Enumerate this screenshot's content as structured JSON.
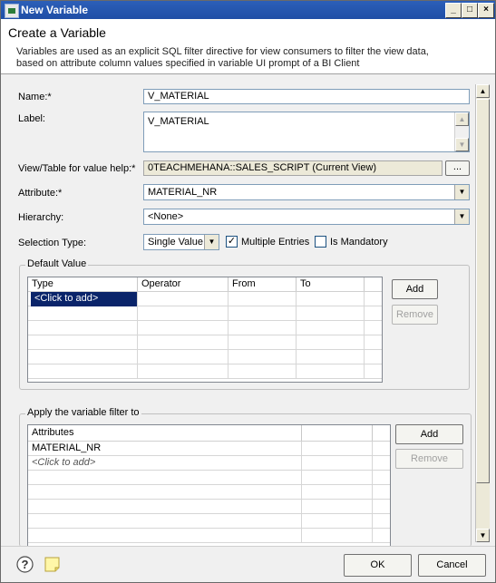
{
  "window": {
    "title": "New Variable",
    "buttons": {
      "minimize": "_",
      "maximize": "□",
      "close": "×"
    }
  },
  "header": {
    "title": "Create a Variable",
    "description": "Variables are used as an explicit SQL filter directive for view consumers to filter the view data, based on attribute column values specified in variable UI prompt of a BI Client"
  },
  "form": {
    "name_label": "Name:*",
    "name_value": "V_MATERIAL",
    "label_label": "Label:",
    "label_value": "V_MATERIAL",
    "view_label": "View/Table for value help:*",
    "view_value": "0TEACHMEHANA::SALES_SCRIPT (Current View)",
    "view_browse": "...",
    "attribute_label": "Attribute:*",
    "attribute_value": "MATERIAL_NR",
    "hierarchy_label": "Hierarchy:",
    "hierarchy_value": "<None>",
    "selection_type_label": "Selection Type:",
    "selection_type_value": "Single Value",
    "multiple_entries_label": "Multiple Entries",
    "multiple_entries_checked": true,
    "is_mandatory_label": "Is Mandatory",
    "is_mandatory_checked": false
  },
  "default_value": {
    "group_title": "Default Value",
    "columns": [
      "Type",
      "Operator",
      "From",
      "To"
    ],
    "rows": [
      {
        "type": "<Click to add>",
        "operator": "",
        "from": "",
        "to": ""
      }
    ],
    "add_button": "Add",
    "remove_button": "Remove"
  },
  "filter": {
    "group_title": "Apply the variable filter to",
    "columns": [
      "Attributes"
    ],
    "rows": [
      "MATERIAL_NR",
      "<Click to add>"
    ],
    "add_button": "Add",
    "remove_button": "Remove"
  },
  "footer": {
    "ok": "OK",
    "cancel": "Cancel"
  },
  "icons": [
    "help-icon",
    "note-icon",
    "app-icon"
  ]
}
